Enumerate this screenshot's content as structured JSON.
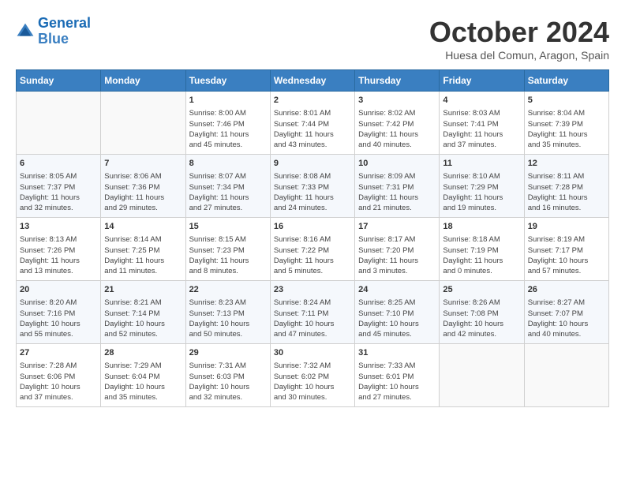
{
  "header": {
    "logo_line1": "General",
    "logo_line2": "Blue",
    "month": "October 2024",
    "location": "Huesa del Comun, Aragon, Spain"
  },
  "weekdays": [
    "Sunday",
    "Monday",
    "Tuesday",
    "Wednesday",
    "Thursday",
    "Friday",
    "Saturday"
  ],
  "weeks": [
    [
      {
        "day": "",
        "info": ""
      },
      {
        "day": "",
        "info": ""
      },
      {
        "day": "1",
        "info": "Sunrise: 8:00 AM\nSunset: 7:46 PM\nDaylight: 11 hours\nand 45 minutes."
      },
      {
        "day": "2",
        "info": "Sunrise: 8:01 AM\nSunset: 7:44 PM\nDaylight: 11 hours\nand 43 minutes."
      },
      {
        "day": "3",
        "info": "Sunrise: 8:02 AM\nSunset: 7:42 PM\nDaylight: 11 hours\nand 40 minutes."
      },
      {
        "day": "4",
        "info": "Sunrise: 8:03 AM\nSunset: 7:41 PM\nDaylight: 11 hours\nand 37 minutes."
      },
      {
        "day": "5",
        "info": "Sunrise: 8:04 AM\nSunset: 7:39 PM\nDaylight: 11 hours\nand 35 minutes."
      }
    ],
    [
      {
        "day": "6",
        "info": "Sunrise: 8:05 AM\nSunset: 7:37 PM\nDaylight: 11 hours\nand 32 minutes."
      },
      {
        "day": "7",
        "info": "Sunrise: 8:06 AM\nSunset: 7:36 PM\nDaylight: 11 hours\nand 29 minutes."
      },
      {
        "day": "8",
        "info": "Sunrise: 8:07 AM\nSunset: 7:34 PM\nDaylight: 11 hours\nand 27 minutes."
      },
      {
        "day": "9",
        "info": "Sunrise: 8:08 AM\nSunset: 7:33 PM\nDaylight: 11 hours\nand 24 minutes."
      },
      {
        "day": "10",
        "info": "Sunrise: 8:09 AM\nSunset: 7:31 PM\nDaylight: 11 hours\nand 21 minutes."
      },
      {
        "day": "11",
        "info": "Sunrise: 8:10 AM\nSunset: 7:29 PM\nDaylight: 11 hours\nand 19 minutes."
      },
      {
        "day": "12",
        "info": "Sunrise: 8:11 AM\nSunset: 7:28 PM\nDaylight: 11 hours\nand 16 minutes."
      }
    ],
    [
      {
        "day": "13",
        "info": "Sunrise: 8:13 AM\nSunset: 7:26 PM\nDaylight: 11 hours\nand 13 minutes."
      },
      {
        "day": "14",
        "info": "Sunrise: 8:14 AM\nSunset: 7:25 PM\nDaylight: 11 hours\nand 11 minutes."
      },
      {
        "day": "15",
        "info": "Sunrise: 8:15 AM\nSunset: 7:23 PM\nDaylight: 11 hours\nand 8 minutes."
      },
      {
        "day": "16",
        "info": "Sunrise: 8:16 AM\nSunset: 7:22 PM\nDaylight: 11 hours\nand 5 minutes."
      },
      {
        "day": "17",
        "info": "Sunrise: 8:17 AM\nSunset: 7:20 PM\nDaylight: 11 hours\nand 3 minutes."
      },
      {
        "day": "18",
        "info": "Sunrise: 8:18 AM\nSunset: 7:19 PM\nDaylight: 11 hours\nand 0 minutes."
      },
      {
        "day": "19",
        "info": "Sunrise: 8:19 AM\nSunset: 7:17 PM\nDaylight: 10 hours\nand 57 minutes."
      }
    ],
    [
      {
        "day": "20",
        "info": "Sunrise: 8:20 AM\nSunset: 7:16 PM\nDaylight: 10 hours\nand 55 minutes."
      },
      {
        "day": "21",
        "info": "Sunrise: 8:21 AM\nSunset: 7:14 PM\nDaylight: 10 hours\nand 52 minutes."
      },
      {
        "day": "22",
        "info": "Sunrise: 8:23 AM\nSunset: 7:13 PM\nDaylight: 10 hours\nand 50 minutes."
      },
      {
        "day": "23",
        "info": "Sunrise: 8:24 AM\nSunset: 7:11 PM\nDaylight: 10 hours\nand 47 minutes."
      },
      {
        "day": "24",
        "info": "Sunrise: 8:25 AM\nSunset: 7:10 PM\nDaylight: 10 hours\nand 45 minutes."
      },
      {
        "day": "25",
        "info": "Sunrise: 8:26 AM\nSunset: 7:08 PM\nDaylight: 10 hours\nand 42 minutes."
      },
      {
        "day": "26",
        "info": "Sunrise: 8:27 AM\nSunset: 7:07 PM\nDaylight: 10 hours\nand 40 minutes."
      }
    ],
    [
      {
        "day": "27",
        "info": "Sunrise: 7:28 AM\nSunset: 6:06 PM\nDaylight: 10 hours\nand 37 minutes."
      },
      {
        "day": "28",
        "info": "Sunrise: 7:29 AM\nSunset: 6:04 PM\nDaylight: 10 hours\nand 35 minutes."
      },
      {
        "day": "29",
        "info": "Sunrise: 7:31 AM\nSunset: 6:03 PM\nDaylight: 10 hours\nand 32 minutes."
      },
      {
        "day": "30",
        "info": "Sunrise: 7:32 AM\nSunset: 6:02 PM\nDaylight: 10 hours\nand 30 minutes."
      },
      {
        "day": "31",
        "info": "Sunrise: 7:33 AM\nSunset: 6:01 PM\nDaylight: 10 hours\nand 27 minutes."
      },
      {
        "day": "",
        "info": ""
      },
      {
        "day": "",
        "info": ""
      }
    ]
  ]
}
